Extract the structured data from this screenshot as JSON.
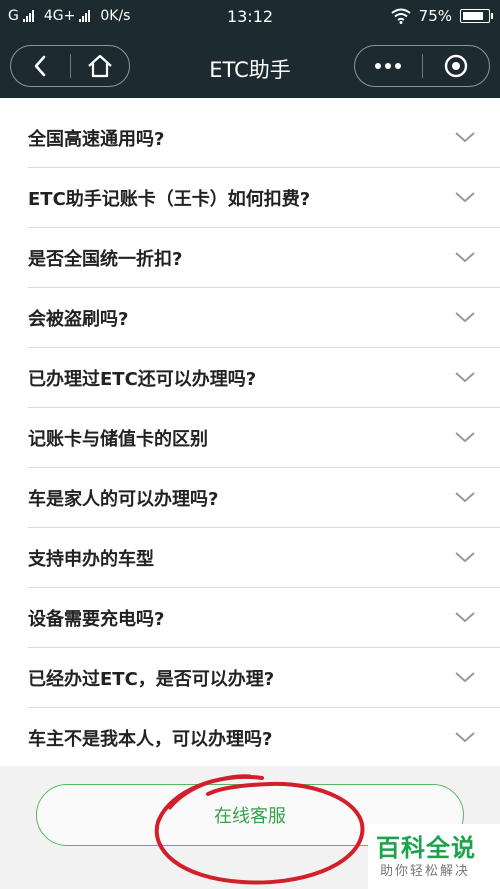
{
  "status_bar": {
    "carrier_left": "G",
    "network": "4G+",
    "speed": "0K/s",
    "time": "13:12",
    "battery": "75%",
    "battery_level": 0.75
  },
  "nav": {
    "title": "ETC助手",
    "icons": [
      "back-icon",
      "home-icon",
      "more-icon",
      "close-target-icon"
    ]
  },
  "faq": {
    "items": [
      {
        "text": "全国高速通用吗?"
      },
      {
        "text": "ETC助手记账卡（王卡）如何扣费?"
      },
      {
        "text": "是否全国统一折扣?"
      },
      {
        "text": "会被盗刷吗?"
      },
      {
        "text": "已办理过ETC还可以办理吗?"
      },
      {
        "text": "记账卡与储值卡的区别"
      },
      {
        "text": "车是家人的可以办理吗?"
      },
      {
        "text": "支持申办的车型"
      },
      {
        "text": "设备需要充电吗?"
      },
      {
        "text": "已经办过ETC，是否可以办理?"
      },
      {
        "text": "车主不是我本人，可以办理吗?"
      }
    ]
  },
  "footer": {
    "customer_service_label": "在线客服",
    "accent_color": "#3aa14b",
    "annotation_color": "#d21f2a"
  },
  "watermark": {
    "title": "百科全说",
    "subtitle": "助你轻松解决"
  }
}
